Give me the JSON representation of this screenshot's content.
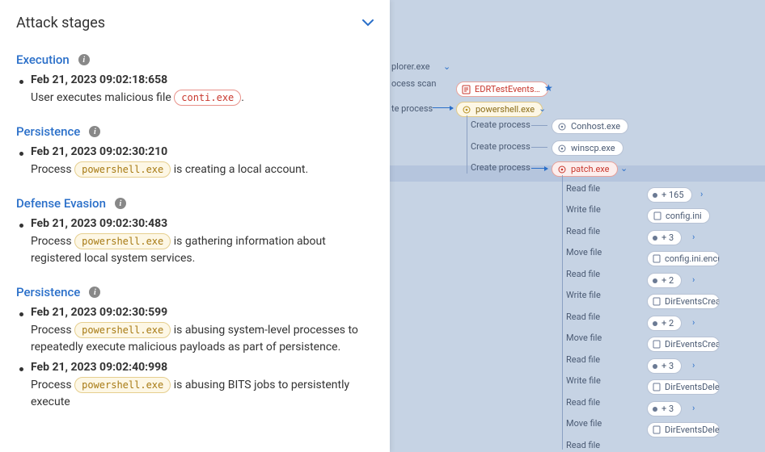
{
  "panel": {
    "title": "Attack stages"
  },
  "stages": [
    {
      "name": "Execution",
      "events": [
        {
          "time": "Feb 21, 2023 09:02:18:658",
          "pre": "User executes malicious file ",
          "token": "conti.exe",
          "token_style": "red",
          "post": "."
        }
      ]
    },
    {
      "name": "Persistence",
      "events": [
        {
          "time": "Feb 21, 2023 09:02:30:210",
          "pre": "Process ",
          "token": "powershell.exe",
          "token_style": "yellow",
          "post": " is creating a local account."
        }
      ]
    },
    {
      "name": "Defense Evasion",
      "events": [
        {
          "time": "Feb 21, 2023 09:02:30:483",
          "pre": "Process ",
          "token": "powershell.exe",
          "token_style": "yellow",
          "post": " is gathering information about registered local system services."
        }
      ]
    },
    {
      "name": "Persistence",
      "events": [
        {
          "time": "Feb 21, 2023 09:02:30:599",
          "pre": "Process ",
          "token": "powershell.exe",
          "token_style": "yellow",
          "post": " is abusing system-level processes to repeatedly execute malicious payloads as part of persistence."
        },
        {
          "time": "Feb 21, 2023 09:02:40:998",
          "pre": "Process ",
          "token": "powershell.exe",
          "token_style": "yellow",
          "post": " is abusing BITS jobs to persistently execute"
        }
      ]
    }
  ],
  "graph": {
    "frag1": "plorer.exe",
    "frag2": "ocess scan",
    "frag3": "te process",
    "edr": "EDRTestEvents…",
    "powershell": "powershell.exe",
    "create_process": "Create process",
    "conhost": "Conhost.exe",
    "winscp": "winscp.exe",
    "patch": "patch.exe",
    "ops": {
      "read": "Read file",
      "write": "Write file",
      "move": "Move file"
    },
    "counts": {
      "c165": "+ 165",
      "c3": "+ 3",
      "c2": "+ 2"
    },
    "files": {
      "config_ini": "config.ini",
      "config_enc": "config.ini.encr…",
      "dir_create": "DirEventsCreat…",
      "dir_delete": "DirEventsDelet…"
    }
  }
}
